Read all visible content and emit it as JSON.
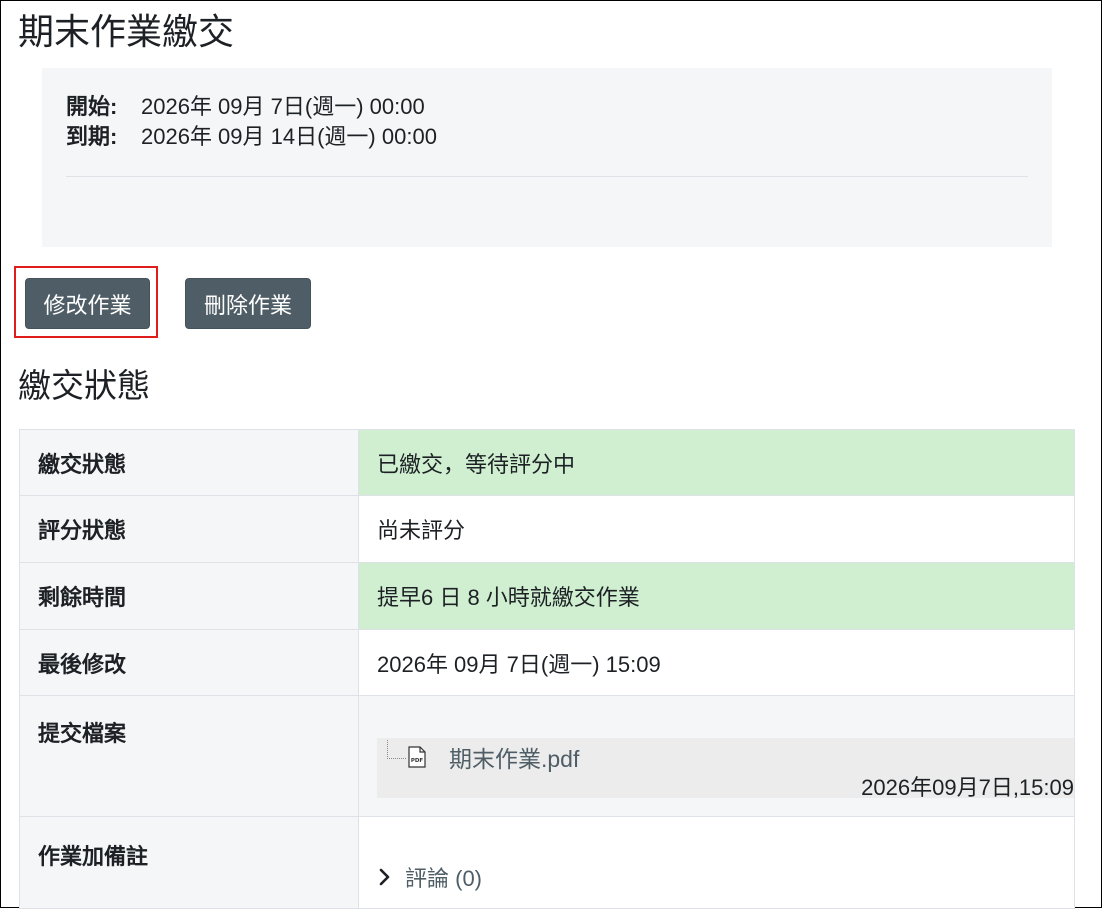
{
  "page": {
    "title": "期末作業繳交"
  },
  "dates": {
    "open_label": "開始:",
    "open_value": "2026年 09月 7日(週一) 00:00",
    "due_label": "到期:",
    "due_value": "2026年 09月 14日(週一) 00:00"
  },
  "actions": {
    "edit_label": "修改作業",
    "delete_label": "刪除作業"
  },
  "status_section": {
    "title": "繳交狀態",
    "rows": [
      {
        "label": "繳交狀態",
        "value": "已繳交，等待評分中",
        "highlight": true
      },
      {
        "label": "評分狀態",
        "value": "尚未評分",
        "highlight": false
      },
      {
        "label": "剩餘時間",
        "value": "提早6 日 8 小時就繳交作業",
        "highlight": true
      },
      {
        "label": "最後修改",
        "value": "2026年 09月 7日(週一) 15:09",
        "highlight": false
      },
      {
        "label": "提交檔案",
        "file_name": "期末作業.pdf",
        "file_time": "2026年09月7日,15:09"
      },
      {
        "label": "作業加備註",
        "comments": "評論 (0)"
      }
    ]
  },
  "colors": {
    "button_bg": "#4f5e66",
    "success_bg": "#cfefd0",
    "highlight_border": "#e01d1d"
  }
}
